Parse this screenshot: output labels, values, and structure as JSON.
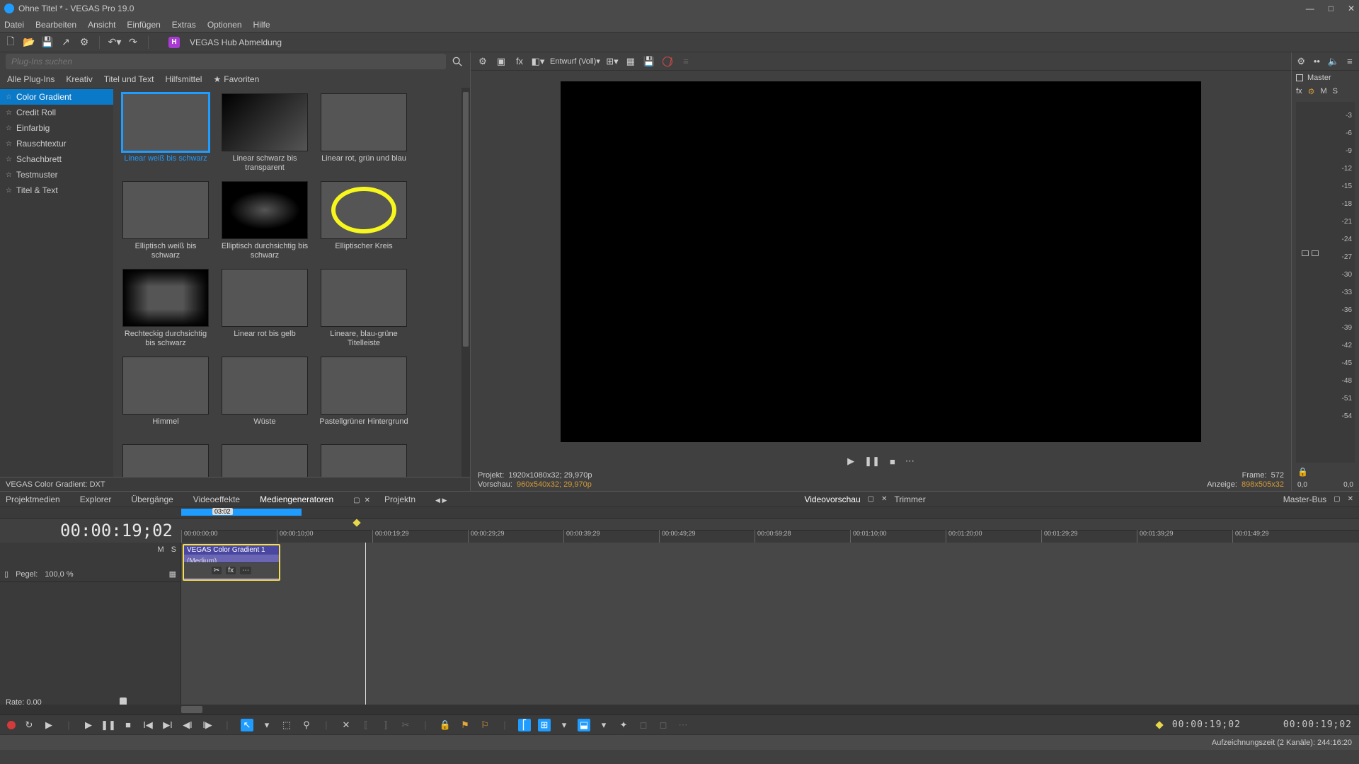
{
  "window": {
    "title": "Ohne Titel * - VEGAS Pro 19.0"
  },
  "menu": [
    "Datei",
    "Bearbeiten",
    "Ansicht",
    "Einfügen",
    "Extras",
    "Optionen",
    "Hilfe"
  ],
  "toolbar": {
    "hub": "H",
    "hub_label": "VEGAS Hub Abmeldung"
  },
  "plugin_browser": {
    "search_placeholder": "Plug-Ins suchen",
    "category_tabs": [
      "Alle Plug-Ins",
      "Kreativ",
      "Titel und Text",
      "Hilfsmittel"
    ],
    "favorites_label": "Favoriten",
    "side_items": [
      "Color Gradient",
      "Credit Roll",
      "Einfarbig",
      "Rauschtextur",
      "Schachbrett",
      "Testmuster",
      "Titel & Text"
    ],
    "side_selected": 0,
    "presets": [
      {
        "label": "Linear weiß bis schwarz",
        "th": "th-lin-wb",
        "sel": true
      },
      {
        "label": "Linear schwarz bis transparent",
        "th": "th-check th-lin-bt"
      },
      {
        "label": "Linear rot, grün und blau",
        "th": "th-rgb"
      },
      {
        "label": "Elliptisch weiß bis schwarz",
        "th": "th-ell-wb"
      },
      {
        "label": "Elliptisch durchsichtig bis schwarz",
        "th": "th-check th-ell-tb"
      },
      {
        "label": "Elliptischer Kreis",
        "th": "th-check th-ell-yr"
      },
      {
        "label": "Rechteckig durchsichtig bis schwarz",
        "th": "th-check th-rect-tb"
      },
      {
        "label": "Linear rot bis gelb",
        "th": "th-ry"
      },
      {
        "label": "Lineare, blau-grüne Titelleiste",
        "th": "th-bluegreen"
      },
      {
        "label": "Himmel",
        "th": "th-himmel"
      },
      {
        "label": "Wüste",
        "th": "th-wueste"
      },
      {
        "label": "Pastellgrüner Hintergrund",
        "th": "th-pastel"
      },
      {
        "label": "",
        "th": "th-ltblue"
      },
      {
        "label": "",
        "th": "th-pink"
      },
      {
        "label": "",
        "th": "th-orange"
      }
    ],
    "status": "VEGAS Color Gradient: DXT"
  },
  "preview": {
    "quality": "Entwurf (Voll)",
    "info": {
      "project_label": "Projekt:",
      "project_value": "1920x1080x32; 29,970p",
      "preview_label": "Vorschau:",
      "preview_value": "960x540x32; 29,970p",
      "frame_label": "Frame:",
      "frame_value": "572",
      "display_label": "Anzeige:",
      "display_value": "898x505x32"
    }
  },
  "lower_tabs": {
    "left": [
      "Projektmedien",
      "Explorer",
      "Übergänge",
      "Videoeffekte",
      "Mediengeneratoren",
      "Projektn"
    ],
    "center": [
      "Videovorschau",
      "Trimmer"
    ],
    "right": "Master-Bus"
  },
  "meter": {
    "title": "Master",
    "sub": [
      "fx",
      "M",
      "S"
    ],
    "scale": [
      "-3",
      "-6",
      "-9",
      "-12",
      "-15",
      "-18",
      "-21",
      "-24",
      "-27",
      "-30",
      "-33",
      "-36",
      "-39",
      "-42",
      "-45",
      "-48",
      "-51",
      "-54"
    ],
    "bottom_l": "0,0",
    "bottom_r": "0,0"
  },
  "timeline": {
    "timecode": "00:00:19;02",
    "region_label": "03:02",
    "ruler": [
      "00:00:00;00",
      "00:00:10;00",
      "00:00:19;29",
      "00:00:29;29",
      "00:00:39;29",
      "00:00:49;29",
      "00:00:59;28",
      "00:01:10;00",
      "00:01:20;00",
      "00:01:29;29",
      "00:01:39;29",
      "00:01:49;29"
    ],
    "track": {
      "mute": "M",
      "solo": "S",
      "level_label": "Pegel:",
      "level_value": "100,0 %"
    },
    "clip": {
      "title": "VEGAS Color Gradient 1",
      "body": "(Medium)"
    },
    "rate_label": "Rate: 0,00",
    "tc_left": "00:00:19;02",
    "tc_right": "00:00:19;02"
  },
  "footer": {
    "rec_time": "Aufzeichnungszeit (2 Kanäle): 244:16:20"
  },
  "gear_icon": "⚙"
}
